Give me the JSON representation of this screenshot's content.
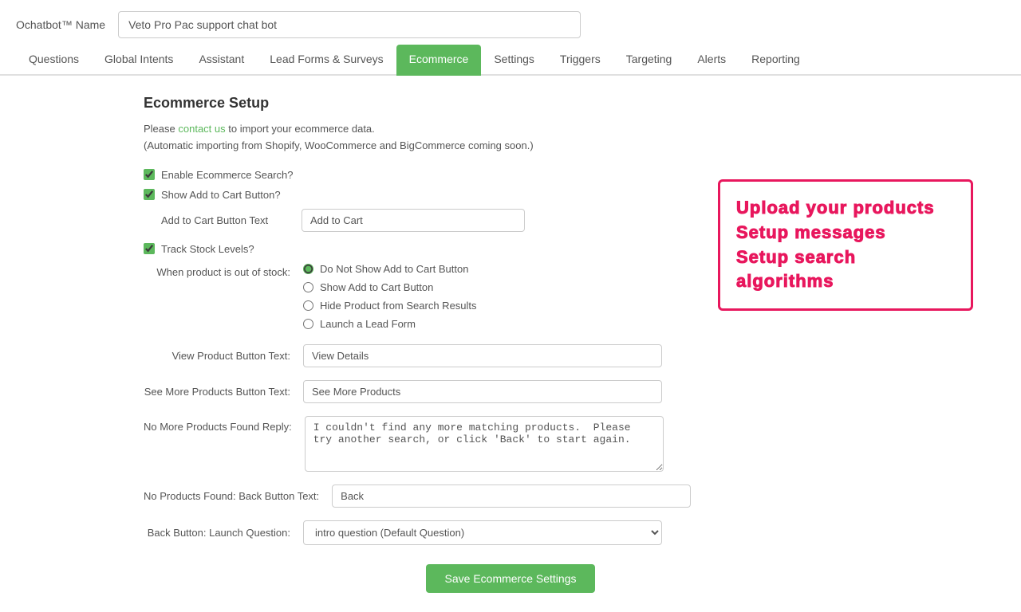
{
  "header": {
    "label": "Ochatbot™ Name",
    "bot_name": "Veto Pro Pac support chat bot"
  },
  "nav": {
    "items": [
      {
        "label": "Questions",
        "active": false
      },
      {
        "label": "Global Intents",
        "active": false
      },
      {
        "label": "Assistant",
        "active": false
      },
      {
        "label": "Lead Forms & Surveys",
        "active": false
      },
      {
        "label": "Ecommerce",
        "active": true
      },
      {
        "label": "Settings",
        "active": false
      },
      {
        "label": "Triggers",
        "active": false
      },
      {
        "label": "Targeting",
        "active": false
      },
      {
        "label": "Alerts",
        "active": false
      },
      {
        "label": "Reporting",
        "active": false
      }
    ]
  },
  "section": {
    "title": "Ecommerce Setup",
    "desc_prefix": "Please ",
    "desc_link": "contact us",
    "desc_suffix": " to import your ecommerce data.",
    "desc_sub": "(Automatic importing from Shopify, WooCommerce and BigCommerce coming soon.)"
  },
  "promo": {
    "line1": "Upload your products",
    "line2": "Setup messages",
    "line3": "Setup search algorithms"
  },
  "form": {
    "enable_ecommerce_label": "Enable Ecommerce Search?",
    "enable_ecommerce_checked": true,
    "show_add_to_cart_label": "Show Add to Cart Button?",
    "show_add_to_cart_checked": true,
    "add_to_cart_btn_label": "Add to Cart Button Text",
    "add_to_cart_btn_value": "Add to Cart",
    "track_stock_label": "Track Stock Levels?",
    "track_stock_checked": true,
    "out_of_stock_label": "When product is out of stock:",
    "out_of_stock_options": [
      {
        "label": "Do Not Show Add to Cart Button",
        "checked": true
      },
      {
        "label": "Show Add to Cart Button",
        "checked": false
      },
      {
        "label": "Hide Product from Search Results",
        "checked": false
      },
      {
        "label": "Launch a Lead Form",
        "checked": false
      }
    ],
    "view_product_label": "View Product Button Text:",
    "view_product_value": "View Details",
    "see_more_label": "See More Products Button Text:",
    "see_more_value": "See More Products",
    "no_more_label": "No More Products Found Reply:",
    "no_more_value": "I couldn't find any more matching products.  Please try another search, or click 'Back' to start again.",
    "no_products_label": "No Products Found: Back Button Text:",
    "no_products_value": "Back",
    "back_button_label": "Back Button: Launch Question:",
    "back_button_value": "intro question (Default Question)",
    "back_button_options": [
      "intro question (Default Question)"
    ],
    "save_label": "Save Ecommerce Settings"
  }
}
